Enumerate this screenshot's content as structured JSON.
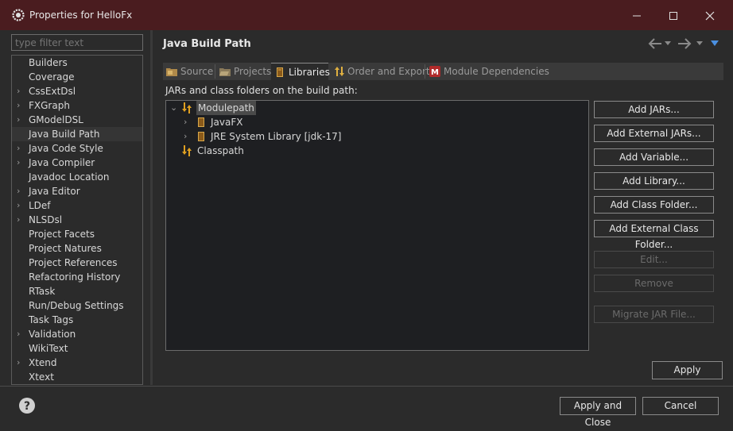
{
  "window": {
    "title": "Properties for HelloFx"
  },
  "filter": {
    "placeholder": "type filter text"
  },
  "sidebar": {
    "items": [
      {
        "label": "Builders",
        "expandable": false
      },
      {
        "label": "Coverage",
        "expandable": false
      },
      {
        "label": "CssExtDsl",
        "expandable": true
      },
      {
        "label": "FXGraph",
        "expandable": true
      },
      {
        "label": "GModelDSL",
        "expandable": true
      },
      {
        "label": "Java Build Path",
        "expandable": false,
        "selected": true
      },
      {
        "label": "Java Code Style",
        "expandable": true
      },
      {
        "label": "Java Compiler",
        "expandable": true
      },
      {
        "label": "Javadoc Location",
        "expandable": false
      },
      {
        "label": "Java Editor",
        "expandable": true
      },
      {
        "label": "LDef",
        "expandable": true
      },
      {
        "label": "NLSDsl",
        "expandable": true
      },
      {
        "label": "Project Facets",
        "expandable": false
      },
      {
        "label": "Project Natures",
        "expandable": false
      },
      {
        "label": "Project References",
        "expandable": false
      },
      {
        "label": "Refactoring History",
        "expandable": false
      },
      {
        "label": "RTask",
        "expandable": false
      },
      {
        "label": "Run/Debug Settings",
        "expandable": false
      },
      {
        "label": "Task Tags",
        "expandable": false
      },
      {
        "label": "Validation",
        "expandable": true
      },
      {
        "label": "WikiText",
        "expandable": false
      },
      {
        "label": "Xtend",
        "expandable": true
      },
      {
        "label": "Xtext",
        "expandable": false
      }
    ]
  },
  "main": {
    "title": "Java Build Path",
    "tabs": [
      {
        "label": "Source"
      },
      {
        "label": "Projects"
      },
      {
        "label": "Libraries",
        "active": true
      },
      {
        "label": "Order and Export"
      },
      {
        "label": "Module Dependencies"
      }
    ],
    "path_label": "JARs and class folders on the build path:",
    "tree": {
      "modulepath": "Modulepath",
      "javafx": "JavaFX",
      "jre": "JRE System Library [jdk-17]",
      "classpath": "Classpath"
    },
    "buttons": {
      "add_jars": "Add JARs...",
      "add_external_jars": "Add External JARs...",
      "add_variable": "Add Variable...",
      "add_library": "Add Library...",
      "add_class_folder": "Add Class Folder...",
      "add_external_class_folder": "Add External Class Folder...",
      "edit": "Edit...",
      "remove": "Remove",
      "migrate_jar": "Migrate JAR File..."
    },
    "apply": "Apply"
  },
  "footer": {
    "apply_and_close": "Apply and Close",
    "cancel": "Cancel"
  },
  "colors": {
    "titlebar": "#4a1c1f",
    "background": "#2b2b2b",
    "accent_blue": "#4a8fe0"
  }
}
